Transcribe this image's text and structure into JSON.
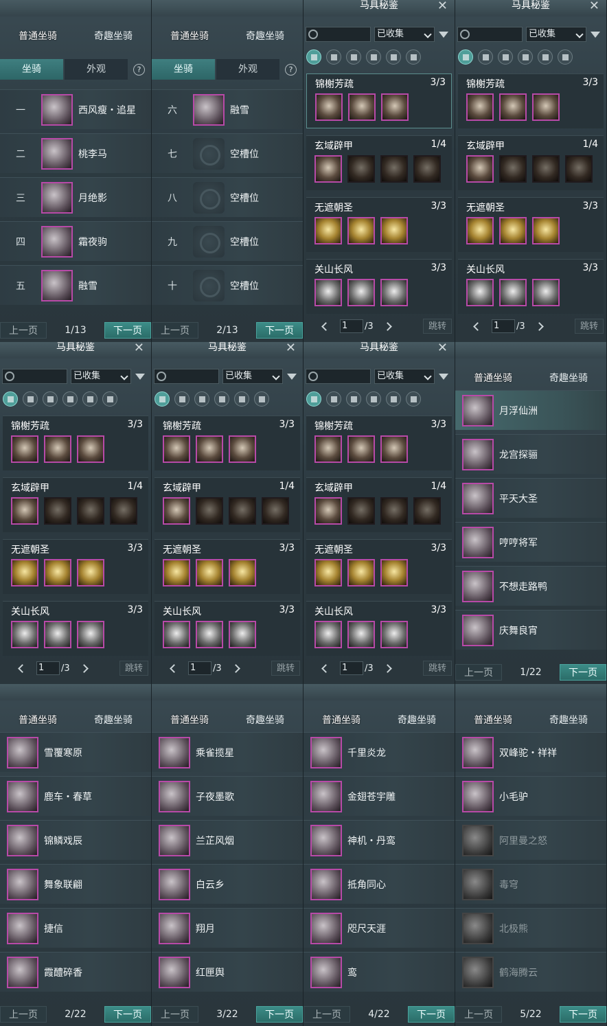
{
  "tabs": {
    "normal": "普通坐骑",
    "special": "奇趣坐骑"
  },
  "subtabs": {
    "mount": "坐骑",
    "appearance": "外观",
    "help": "?"
  },
  "pager": {
    "prev": "上一页",
    "next": "下一页"
  },
  "catalogue": {
    "title": "马具秘鉴",
    "filter": "已收集",
    "jump": "跳转",
    "page": "1",
    "total": "/3",
    "close": "✕"
  },
  "slotPanels": [
    {
      "page": "1/13",
      "rows": [
        {
          "num": "一",
          "name": "西风瘦・追星",
          "empty": false
        },
        {
          "num": "二",
          "name": "桃李马",
          "empty": false
        },
        {
          "num": "三",
          "name": "月绝影",
          "empty": false
        },
        {
          "num": "四",
          "name": "霜夜驹",
          "empty": false
        },
        {
          "num": "五",
          "name": "融雪",
          "empty": false
        }
      ]
    },
    {
      "page": "2/13",
      "rows": [
        {
          "num": "六",
          "name": "融雪",
          "empty": false
        },
        {
          "num": "七",
          "name": "空槽位",
          "empty": true
        },
        {
          "num": "八",
          "name": "空槽位",
          "empty": true
        },
        {
          "num": "九",
          "name": "空槽位",
          "empty": true
        },
        {
          "num": "十",
          "name": "空槽位",
          "empty": true
        }
      ]
    }
  ],
  "sets": [
    {
      "name": "锦榭芳疏",
      "count": "3/3",
      "items": [
        "",
        "",
        ""
      ]
    },
    {
      "name": "玄域辟甲",
      "count": "1/4",
      "items": [
        "",
        "dark",
        "dark",
        "dark"
      ]
    },
    {
      "name": "无遮朝圣",
      "count": "3/3",
      "items": [
        "gold",
        "gold",
        "gold"
      ]
    },
    {
      "name": "关山长风",
      "count": "3/3",
      "items": [
        "silver",
        "silver",
        "silver"
      ]
    }
  ],
  "mountPanels": [
    {
      "page": "1/22",
      "rows": [
        {
          "name": "月浮仙洲",
          "dim": false,
          "sel": true
        },
        {
          "name": "龙宫探骊",
          "dim": false
        },
        {
          "name": "平天大圣",
          "dim": false
        },
        {
          "name": "哼哼将军",
          "dim": false
        },
        {
          "name": "不想走路鸭",
          "dim": false
        },
        {
          "name": "庆舞良宵",
          "dim": false
        }
      ]
    },
    {
      "page": "2/22",
      "rows": [
        {
          "name": "雪覆寒原",
          "dim": false
        },
        {
          "name": "鹿车・春草",
          "dim": false
        },
        {
          "name": "锦鳞戏辰",
          "dim": false
        },
        {
          "name": "舞象联翩",
          "dim": false
        },
        {
          "name": "捷信",
          "dim": false
        },
        {
          "name": "霞醴碎香",
          "dim": false
        }
      ]
    },
    {
      "page": "3/22",
      "rows": [
        {
          "name": "乘雀揽星",
          "dim": false
        },
        {
          "name": "子夜墨歌",
          "dim": false
        },
        {
          "name": "兰芷风烟",
          "dim": false
        },
        {
          "name": "白云乡",
          "dim": false
        },
        {
          "name": "翔月",
          "dim": false
        },
        {
          "name": "红匣舆",
          "dim": false
        }
      ]
    },
    {
      "page": "4/22",
      "rows": [
        {
          "name": "千里炎龙",
          "dim": false
        },
        {
          "name": "金翅苍宇雕",
          "dim": false
        },
        {
          "name": "神机・丹鸾",
          "dim": false
        },
        {
          "name": "抵角同心",
          "dim": false
        },
        {
          "name": "咫尺天涯",
          "dim": false
        },
        {
          "name": "鸾",
          "dim": false
        }
      ]
    },
    {
      "page": "5/22",
      "rows": [
        {
          "name": "双峰驼・祥祥",
          "dim": false
        },
        {
          "name": "小毛驴",
          "dim": false
        },
        {
          "name": "阿里曼之怒",
          "dim": true
        },
        {
          "name": "毒穹",
          "dim": true
        },
        {
          "name": "北极熊",
          "dim": true
        },
        {
          "name": "鹤海腾云",
          "dim": true
        }
      ]
    }
  ]
}
